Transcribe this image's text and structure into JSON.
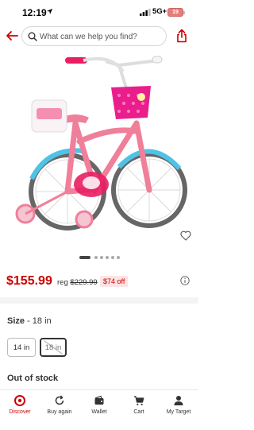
{
  "status": {
    "time": "12:19",
    "network": "5G+",
    "battery": "19"
  },
  "header": {
    "search_placeholder": "What can we help you find?"
  },
  "product": {
    "price": "$155.99",
    "reg_label": "reg",
    "reg_price": "$229.99",
    "discount": "$74 off",
    "image_icon": "kids-bicycle-photo"
  },
  "size": {
    "label": "Size",
    "separator": " - ",
    "selected": "18 in",
    "options": [
      "14 in",
      "18 in"
    ]
  },
  "availability": "Out of stock",
  "tabs": [
    {
      "label": "Discover",
      "icon": "target-icon"
    },
    {
      "label": "Buy again",
      "icon": "refresh-icon"
    },
    {
      "label": "Wallet",
      "icon": "wallet-icon"
    },
    {
      "label": "Cart",
      "icon": "cart-icon"
    },
    {
      "label": "My Target",
      "icon": "person-icon"
    }
  ],
  "colors": {
    "brand_red": "#cc0000",
    "bike_pink": "#f07f9a",
    "bike_blue": "#4fc3e6"
  }
}
